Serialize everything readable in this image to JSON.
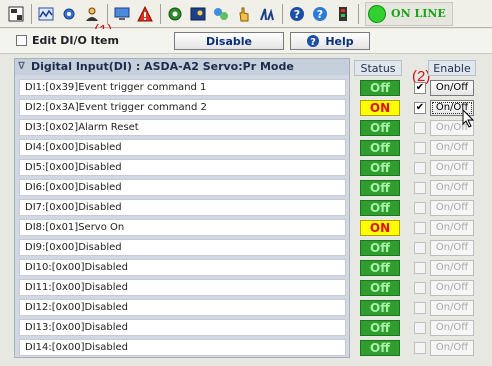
{
  "toolbar": {
    "buttons": [
      "save-icon",
      "monitor-icon",
      "settings-icon",
      "user-icon",
      "computer-icon",
      "warning-icon",
      "gear-icon",
      "card-icon",
      "network-icon",
      "hand-icon",
      "stats-icon",
      "help-icon",
      "question-icon",
      "device-icon"
    ],
    "status_label": "ON LINE",
    "status_color": "#2fd02f"
  },
  "annotations": {
    "a1": "(1)",
    "a2": "(2)"
  },
  "options": {
    "edit_label": "Edit DI/O Item",
    "disable_label": "Disable",
    "help_label": "Help"
  },
  "panel": {
    "title": "Digital Input(DI) : ASDA-A2 Servo:Pr Mode",
    "status_header": "Status",
    "enable_header": "Enable"
  },
  "rows": [
    {
      "label": "DI1:[0x39]Event trigger command 1",
      "status": "Off",
      "enabled": true
    },
    {
      "label": "DI2:[0x3A]Event trigger command 2",
      "status": "ON",
      "enabled": true
    },
    {
      "label": "DI3:[0x02]Alarm Reset",
      "status": "Off",
      "enabled": false
    },
    {
      "label": "DI4:[0x00]Disabled",
      "status": "Off",
      "enabled": false
    },
    {
      "label": "DI5:[0x00]Disabled",
      "status": "Off",
      "enabled": false
    },
    {
      "label": "DI6:[0x00]Disabled",
      "status": "Off",
      "enabled": false
    },
    {
      "label": "DI7:[0x00]Disabled",
      "status": "Off",
      "enabled": false
    },
    {
      "label": "DI8:[0x01]Servo On",
      "status": "ON",
      "enabled": false
    },
    {
      "label": "DI9:[0x00]Disabled",
      "status": "Off",
      "enabled": false
    },
    {
      "label": "DI10:[0x00]Disabled",
      "status": "Off",
      "enabled": false
    },
    {
      "label": "DI11:[0x00]Disabled",
      "status": "Off",
      "enabled": false
    },
    {
      "label": "DI12:[0x00]Disabled",
      "status": "Off",
      "enabled": false
    },
    {
      "label": "DI13:[0x00]Disabled",
      "status": "Off",
      "enabled": false
    },
    {
      "label": "DI14:[0x00]Disabled",
      "status": "Off",
      "enabled": false
    }
  ],
  "enable_button_label": "On/Off",
  "colors": {
    "status_off": "#2f9e2f",
    "status_on": "#ffff00",
    "annotation": "#d4101a"
  }
}
